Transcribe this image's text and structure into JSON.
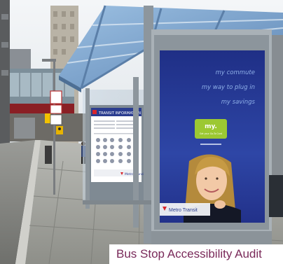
{
  "caption": "Bus Stop Accessibility Audit",
  "transit_panel": {
    "header": "TRANSIT INFORMATION",
    "footer_logo": "Metro Transit"
  },
  "advertisement": {
    "lines": [
      "my commute",
      "my way to plug in",
      "my savings"
    ],
    "badge_text": "my.",
    "badge_subtext": "Get your Go-To Card",
    "brand": "Metro Transit",
    "colors": {
      "background": "#2b3f9c",
      "badge": "#9cc832",
      "text": "#8fb0e8"
    }
  },
  "icons": [
    "walk-sign-icon",
    "street-sign-icon",
    "metro-transit-logo-icon"
  ]
}
